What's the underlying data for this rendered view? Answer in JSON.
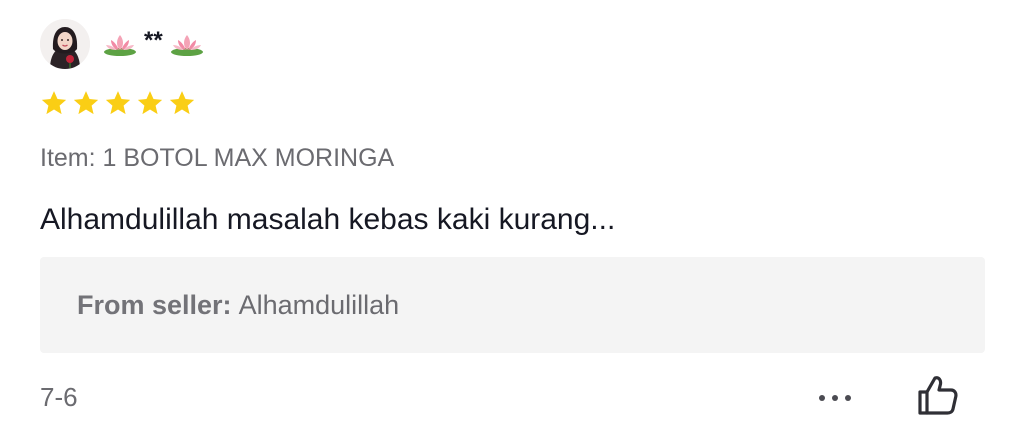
{
  "reviewer": {
    "name": "**",
    "avatar_icon": "avatar-hijab-girl",
    "decoration_icon": "lotus-icon"
  },
  "rating": {
    "stars": 5,
    "max": 5,
    "color": "#FACE15"
  },
  "item": {
    "text": "Item: 1 BOTOL MAX MORINGA"
  },
  "review": {
    "text": "Alhamdulillah masalah kebas kaki kurang..."
  },
  "seller_reply": {
    "label": "From seller:",
    "text": "Alhamdulillah"
  },
  "footer": {
    "date": "7-6",
    "more_icon": "more-horizontal-icon",
    "like_icon": "thumbs-up-icon"
  }
}
